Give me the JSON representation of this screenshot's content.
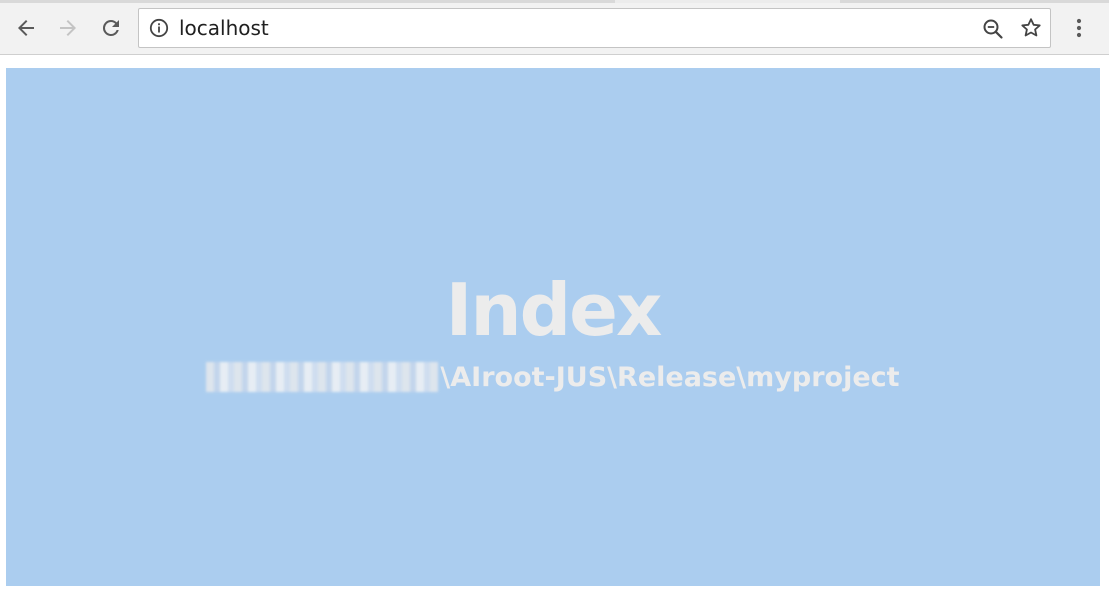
{
  "browser": {
    "address_bar": {
      "url": "localhost",
      "info_icon": "info-icon",
      "zoom_icon": "zoom-out-icon",
      "bookmark_icon": "star-icon"
    },
    "nav": {
      "back_icon": "arrow-left-icon",
      "forward_icon": "arrow-right-icon",
      "reload_icon": "reload-icon",
      "menu_icon": "kebab-menu-icon"
    }
  },
  "page": {
    "background_color": "#abcdef",
    "text_color": "#ececec",
    "title": "Index",
    "path_visible": "\\AIroot-JUS\\Release\\myproject"
  }
}
